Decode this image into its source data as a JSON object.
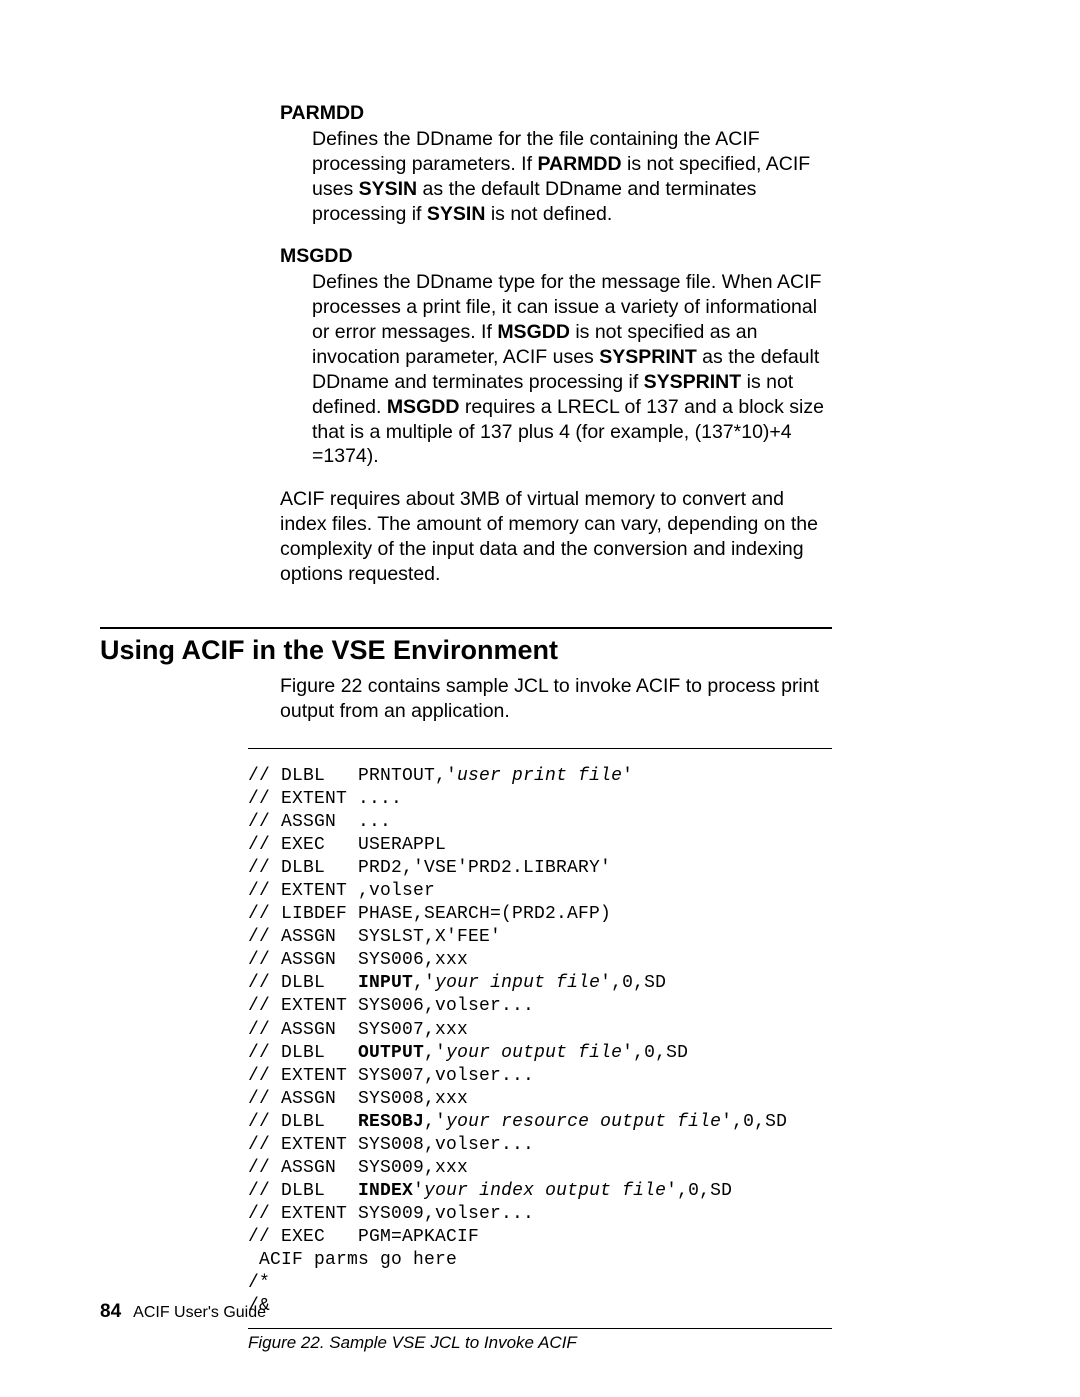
{
  "terms": {
    "parmdd": {
      "label": "PARMDD",
      "desc_pre1": "Defines the DDname for the file containing the ACIF processing parameters.  If ",
      "kw1": "PARMDD",
      "desc_mid1": " is not specified, ACIF uses ",
      "kw2": "SYSIN",
      "desc_mid2": " as the default DDname and terminates processing if ",
      "kw3": "SYSIN",
      "desc_post": " is not defined."
    },
    "msgdd": {
      "label": "MSGDD",
      "d1": "Defines the DDname type for the message file. When ACIF processes a print file, it can issue a variety of informational or error messages. If ",
      "kw1": "MSGDD",
      "d2": " is not specified as an invocation parameter, ACIF uses ",
      "kw2": "SYSPRINT",
      "d3": " as the default DDname and terminates processing if ",
      "kw3": "SYSPRINT",
      "d4": " is not defined. ",
      "kw4": "MSGDD",
      "d5": " requires a LRECL of 137 and a block size that is a multiple of 137 plus 4 (for example, (137*10)+4 =1374)."
    }
  },
  "para1": "ACIF requires about 3MB of virtual memory to convert and index files. The amount of memory can vary, depending on the complexity of the input data and the conversion and indexing options requested.",
  "section_title": "Using ACIF in the VSE Environment",
  "para2": "Figure  22 contains sample JCL to invoke ACIF to process print output from an application.",
  "code": {
    "l01a": "// DLBL   PRNTOUT,'",
    "l01i": "user print file",
    "l01b": "'",
    "l02": "// EXTENT ....",
    "l03": "// ASSGN  ...",
    "l04": "// EXEC   USERAPPL",
    "l05": "// DLBL   PRD2,'VSE'PRD2.LIBRARY'",
    "l06": "// EXTENT ,volser",
    "l07": "// LIBDEF PHASE,SEARCH=(PRD2.AFP)",
    "l08": "// ASSGN  SYSLST,X'FEE'",
    "l09": "// ASSGN  SYS006,xxx",
    "l10a": "// DLBL   ",
    "l10b": "INPUT",
    "l10c": ",'",
    "l10i": "your input file",
    "l10d": "',0,SD",
    "l11": "// EXTENT SYS006,volser...",
    "l12": "// ASSGN  SYS007,xxx",
    "l13a": "// DLBL   ",
    "l13b": "OUTPUT",
    "l13c": ",'",
    "l13i": "your output file",
    "l13d": "',0,SD",
    "l14": "// EXTENT SYS007,volser...",
    "l15": "// ASSGN  SYS008,xxx",
    "l16a": "// DLBL   ",
    "l16b": "RESOBJ",
    "l16c": ",'",
    "l16i": "your resource output file",
    "l16d": "',0,SD",
    "l17": "// EXTENT SYS008,volser...",
    "l18": "// ASSGN  SYS009,xxx",
    "l19a": "// DLBL   ",
    "l19b": "INDEX",
    "l19c": "'",
    "l19i": "your index output file",
    "l19d": "',0,SD",
    "l20": "// EXTENT SYS009,volser...",
    "l21": "// EXEC   PGM=APKACIF",
    "l22": " ACIF parms go here",
    "l23": "/*",
    "l24": "/&"
  },
  "caption": "Figure  22. Sample VSE JCL to Invoke ACIF",
  "footer": {
    "page": "84",
    "title": "ACIF User's Guide"
  }
}
